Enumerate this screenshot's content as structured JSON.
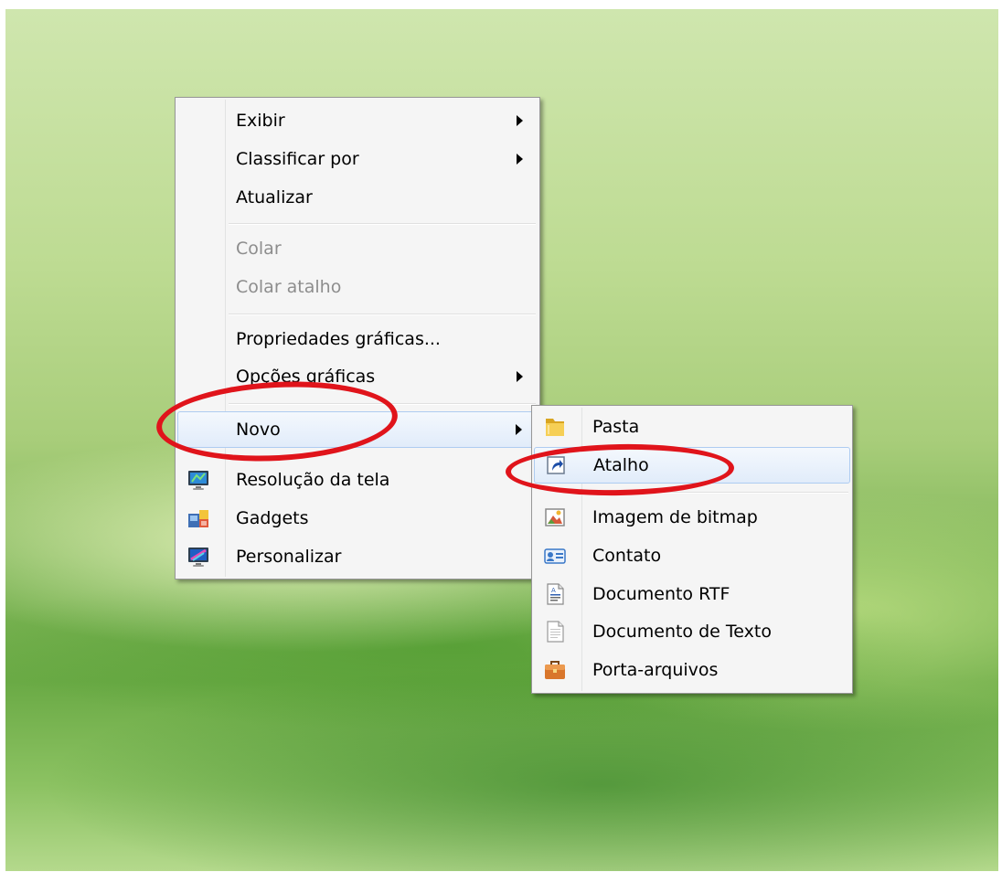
{
  "context_menu": {
    "items": [
      {
        "label": "Exibir",
        "submenu": true
      },
      {
        "label": "Classificar por",
        "submenu": true
      },
      {
        "label": "Atualizar"
      },
      {
        "label": "Colar",
        "disabled": true
      },
      {
        "label": "Colar atalho",
        "disabled": true
      },
      {
        "label": "Propriedades gráficas..."
      },
      {
        "label": "Opções gráficas",
        "submenu": true
      },
      {
        "label": "Novo",
        "submenu": true,
        "highlighted": true
      },
      {
        "label": "Resolução da tela",
        "icon": "monitor-icon"
      },
      {
        "label": "Gadgets",
        "icon": "gadgets-icon"
      },
      {
        "label": "Personalizar",
        "icon": "personalize-icon"
      }
    ]
  },
  "new_submenu": {
    "items": [
      {
        "label": "Pasta",
        "icon": "folder-icon"
      },
      {
        "label": "Atalho",
        "icon": "shortcut-icon",
        "highlighted": true
      },
      {
        "label": "Imagem de bitmap",
        "icon": "bitmap-icon"
      },
      {
        "label": "Contato",
        "icon": "contact-icon"
      },
      {
        "label": "Documento RTF",
        "icon": "rtf-document-icon"
      },
      {
        "label": "Documento de Texto",
        "icon": "text-document-icon"
      },
      {
        "label": "Porta-arquivos",
        "icon": "briefcase-icon"
      }
    ]
  },
  "annotation": {
    "color": "#e0141b"
  }
}
